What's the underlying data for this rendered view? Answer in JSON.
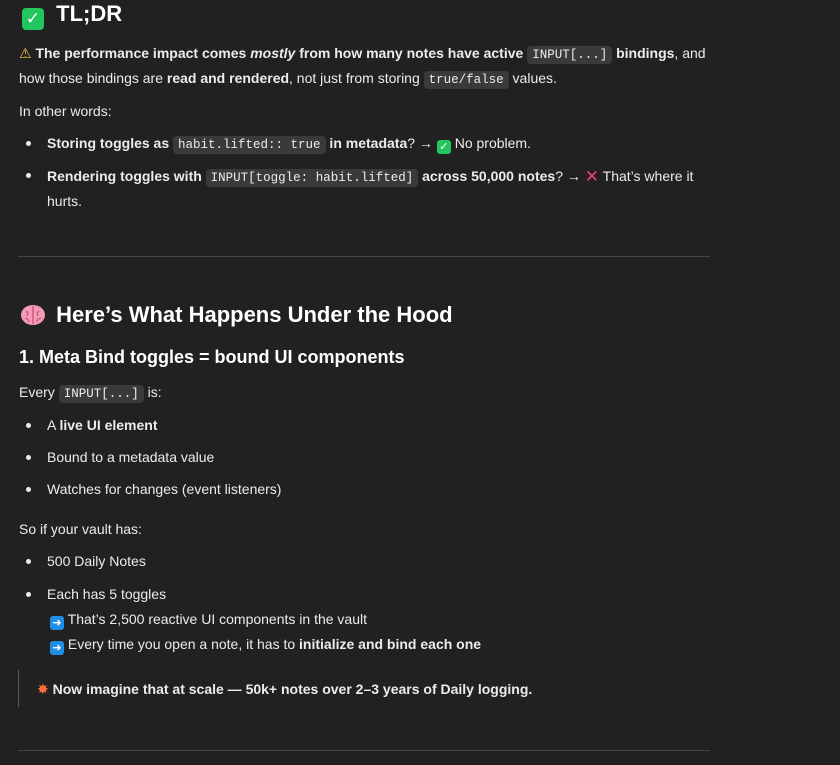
{
  "tldr": {
    "icon": "check-icon",
    "title": "TL;DR",
    "line1": {
      "icon": "warning-icon",
      "t1": "The performance impact comes ",
      "t2": "mostly",
      "t3": " from how many notes have active ",
      "code1": "INPUT[...]",
      "t4": " bindings",
      "t5": ", and"
    },
    "line2": {
      "t1": "how those bindings are ",
      "t2": "read and rendered",
      "t3": ", not just from storing ",
      "code1": "true/false",
      "t4": " values."
    },
    "other_words": "In other words:",
    "bullet1": {
      "t1": "Storing toggles as ",
      "code1": "habit.lifted:: true",
      "t2": " in metadata",
      "t3": "? → ",
      "icon": "check-icon",
      "t4": " No problem."
    },
    "bullet2": {
      "t1": "Rendering toggles with ",
      "code1": "INPUT[toggle: habit.lifted]",
      "t2": " across 50,000 notes",
      "t3": "? → ",
      "icon": "cross-icon",
      "t4": " That’s where it",
      "t5": "hurts."
    }
  },
  "hood": {
    "icon": "brain-icon",
    "title": "Here’s What Happens Under the Hood",
    "sub1": "1. Meta Bind toggles = bound UI components",
    "every": {
      "t1": "Every ",
      "code1": "INPUT[...]",
      "t2": " is:"
    },
    "items": {
      "a": {
        "t1": "A ",
        "t2": "live UI element"
      },
      "b": "Bound to a metadata value",
      "c": "Watches for changes (event listeners)"
    },
    "vault": "So if your vault has:",
    "vault_items": {
      "a": "500 Daily Notes",
      "b": "Each has 5 toggles"
    },
    "arrows": {
      "a": "That’s 2,500 reactive UI components in the vault",
      "b1": "Every time you open a note, it has to ",
      "b2": "initialize and bind each one"
    },
    "quote": "Now imagine that at scale — 50k+ notes over 2–3 years of Daily logging.",
    "quote_icon": "collision-icon"
  },
  "colors": {
    "background": "#212121",
    "text": "#ececec",
    "check": "#22c55e",
    "cross": "#f0406a",
    "arrow": "#1f8fe6"
  }
}
